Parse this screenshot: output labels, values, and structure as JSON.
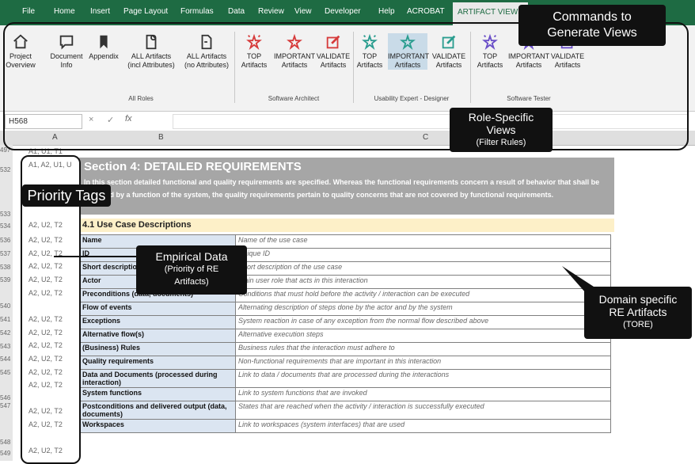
{
  "ribbon": {
    "tabs": [
      "File",
      "Home",
      "Insert",
      "Page Layout",
      "Formulas",
      "Data",
      "Review",
      "View",
      "Developer",
      "Help",
      "ACROBAT",
      "ARTIFACT VIEWS"
    ],
    "buttons": [
      {
        "l1": "Project",
        "l2": "Overview",
        "icon": "house-icon"
      },
      {
        "l1": "Document",
        "l2": "Info",
        "icon": "comment-icon"
      },
      {
        "l1": "Appendix",
        "l2": "",
        "icon": "bookmark-icon"
      },
      {
        "l1": "ALL Artifacts",
        "l2": "(incl Attributes)",
        "icon": "doc-gear-icon"
      },
      {
        "l1": "ALL Artifacts",
        "l2": "(no Attributes)",
        "icon": "doc-icon"
      },
      {
        "l1": "TOP",
        "l2": "Artifacts",
        "icon": "stars-icon"
      },
      {
        "l1": "IMPORTANT",
        "l2": "Artifacts",
        "icon": "star-icon"
      },
      {
        "l1": "VALIDATE",
        "l2": "Artifacts",
        "icon": "pencil-icon"
      },
      {
        "l1": "TOP",
        "l2": "Artifacts",
        "icon": "stars-icon"
      },
      {
        "l1": "IMPORTANT",
        "l2": "Artifacts",
        "icon": "star-icon"
      },
      {
        "l1": "VALIDATE",
        "l2": "Artifacts",
        "icon": "pencil-icon"
      },
      {
        "l1": "TOP",
        "l2": "Artifacts",
        "icon": "stars-icon"
      },
      {
        "l1": "IMPORTANT",
        "l2": "Artifacts",
        "icon": "star-icon"
      },
      {
        "l1": "VALIDATE",
        "l2": "Artifacts",
        "icon": "pencil-icon"
      }
    ],
    "groups": [
      "All Roles",
      "Software Architect",
      "Usability Expert - Designer",
      "Software Tester"
    ],
    "colors": {
      "architect": "#d63b3b",
      "usability": "#2a9d8f",
      "tester": "#6a4fc8"
    }
  },
  "formula": {
    "namebox": "H568",
    "fx": "fx",
    "cancel": "×",
    "enter": "✓"
  },
  "columns": [
    "A",
    "B",
    "C"
  ],
  "rows": {
    "nums": [
      "497",
      "532",
      "533",
      "534",
      "536",
      "537",
      "538",
      "539",
      "540",
      "541",
      "542",
      "543",
      "544",
      "545",
      "546",
      "547",
      "548",
      "549"
    ],
    "tags_top": [
      "A1, U1, T1",
      "A1, A2, U1, U"
    ]
  },
  "section": {
    "title": "Section 4: DETAILED REQUIREMENTS",
    "body": "In this section detailed functional and quality requirements are specified. Whereas the functional requirements concern a result of behavior that shall be provided by a function of the system, the quality requirements pertain to quality concerns that are not covered by functional requirements."
  },
  "uc_header": "4.1 Use Case Descriptions",
  "table": [
    {
      "tag": "A2, U2, T2",
      "k": "Name",
      "v": "Name of the use case"
    },
    {
      "tag": "A2, U2, T2",
      "k": "ID",
      "v": "Unique ID"
    },
    {
      "tag": "A2, U2, T2",
      "k": "Short description",
      "v": "Short description of the use case"
    },
    {
      "tag": "A2, U2, T2",
      "k": "Actor",
      "v": "Main user role that acts in this interaction"
    },
    {
      "tag": "A2, U2, T2",
      "k": "Preconditions (data, documents)",
      "v": "Conditions that must hold before the activity / interaction can be executed"
    },
    {
      "tag": "A2, U2, T2",
      "k": "Flow of events",
      "v": "Alternating description of steps done by the actor and by the system"
    },
    {
      "tag": "A2, U2, T2",
      "k": "Exceptions",
      "v": "System reaction in case of any exception from the normal flow described above"
    },
    {
      "tag": "A2, U2, T2",
      "k": "Alternative flow(s)",
      "v": "Alternative execution steps"
    },
    {
      "tag": "A2, U2, T2",
      "k": "(Business) Rules",
      "v": "Business rules that the interaction must adhere to"
    },
    {
      "tag": "A2, U2, T2",
      "k": "Quality requirements",
      "v": "Non-functional requirements that are important in this interaction"
    },
    {
      "tag": "A2, U2, T2",
      "k": "Data and Documents (processed during interaction)",
      "v": "Link to data / documents that are processed during the interactions"
    },
    {
      "tag": "A2, U2, T2",
      "k": "System functions",
      "v": "Link to system functions that are invoked"
    },
    {
      "tag": "A2, U2, T2",
      "k": "Postconditions and delivered output (data, documents)",
      "v": "States that are reached when the activity / interaction is successfully executed"
    },
    {
      "tag": "A2, U2, T2",
      "k": "Workspaces",
      "v": "Link to workspaces (system interfaces) that are used"
    }
  ],
  "callouts": {
    "commands": "Commands to Generate Views",
    "role_views_1": "Role-Specific",
    "role_views_2": "Views",
    "role_views_3": "(Filter Rules)",
    "priority": "Priority Tags",
    "empirical_1": "Empirical Data",
    "empirical_2": "(Priority of RE",
    "empirical_3": "Artifacts)",
    "domain_1": "Domain specific",
    "domain_2": "RE Artifacts",
    "domain_3": "(TORE)"
  }
}
